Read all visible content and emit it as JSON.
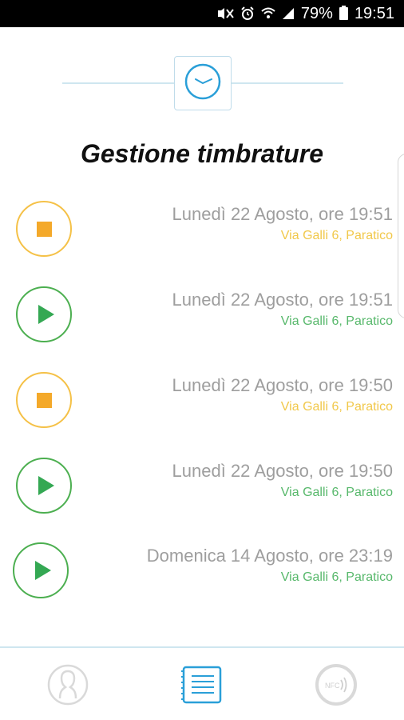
{
  "status_bar": {
    "battery": "79%",
    "time": "19:51"
  },
  "page": {
    "title": "Gestione timbrature"
  },
  "entries": [
    {
      "type": "stop",
      "date": "Lunedì 22 Agosto, ore 19:51",
      "address": "Via Galli 6, Paratico"
    },
    {
      "type": "start",
      "date": "Lunedì 22 Agosto, ore 19:51",
      "address": "Via Galli 6, Paratico"
    },
    {
      "type": "stop",
      "date": "Lunedì 22 Agosto, ore 19:50",
      "address": "Via Galli 6, Paratico"
    },
    {
      "type": "start",
      "date": "Lunedì 22 Agosto, ore 19:50",
      "address": "Via Galli 6, Paratico"
    },
    {
      "type": "start",
      "date": "Domenica 14 Agosto, ore 23:19",
      "address": "Via Galli 6, Paratico"
    }
  ],
  "bottom_nav": {
    "nfc_label": "NFC",
    "items": [
      "profile-icon",
      "list-icon",
      "nfc-icon"
    ]
  },
  "colors": {
    "stop": "#f4a92a",
    "start": "#34a853",
    "accent": "#2a9fd8",
    "date_text": "#9e9e9e"
  }
}
